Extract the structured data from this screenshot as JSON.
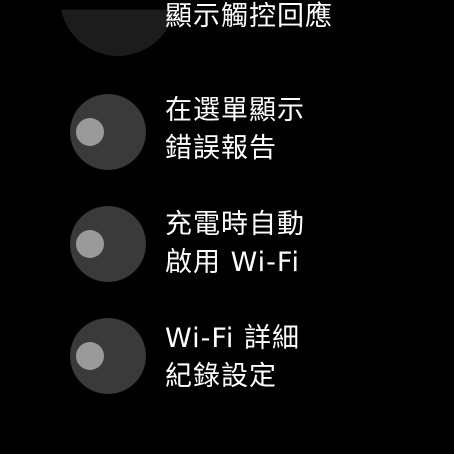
{
  "settings": {
    "items": [
      {
        "label_line1": "顯示觸控回應",
        "label_line2": "",
        "enabled": false
      },
      {
        "label_line1": "在選單顯示",
        "label_line2": "錯誤報告",
        "enabled": false
      },
      {
        "label_line1": "充電時自動",
        "label_line2": "啟用 Wi-Fi",
        "enabled": false
      },
      {
        "label_line1": "Wi-Fi 詳細",
        "label_line2": "紀錄設定",
        "enabled": false
      }
    ]
  },
  "colors": {
    "background": "#000000",
    "toggle_off_track": "#3a3a3a",
    "toggle_off_knob": "#9a9a9a",
    "text": "#ffffff"
  }
}
